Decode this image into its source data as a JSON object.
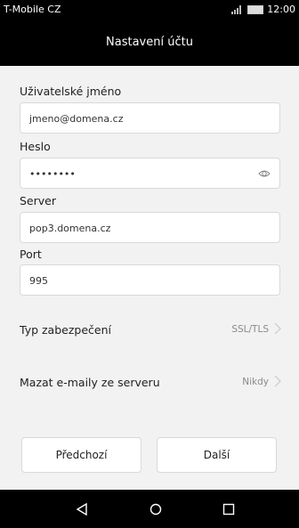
{
  "statusbar": {
    "carrier": "T-Mobile CZ",
    "time": "12:00"
  },
  "titlebar": {
    "title": "Nastavení účtu"
  },
  "form": {
    "username": {
      "label": "Uživatelské jméno",
      "value": "jmeno@domena.cz"
    },
    "password": {
      "label": "Heslo",
      "value": "••••••••"
    },
    "server": {
      "label": "Server",
      "value": "pop3.domena.cz"
    },
    "port": {
      "label": "Port",
      "value": "995"
    }
  },
  "settings": [
    {
      "label": "Typ zabezpečení",
      "value": "SSL/TLS"
    },
    {
      "label": "Mazat e-maily ze serveru",
      "value": "Nikdy"
    }
  ],
  "buttons": {
    "previous": "Předchozí",
    "next": "Další"
  },
  "icons": {
    "signal": "signal-icon",
    "battery": "battery-icon",
    "eye": "eye-icon",
    "chevron": "chevron-right-icon",
    "nav_back": "back-icon",
    "nav_home": "home-icon",
    "nav_recent": "recent-apps-icon"
  }
}
